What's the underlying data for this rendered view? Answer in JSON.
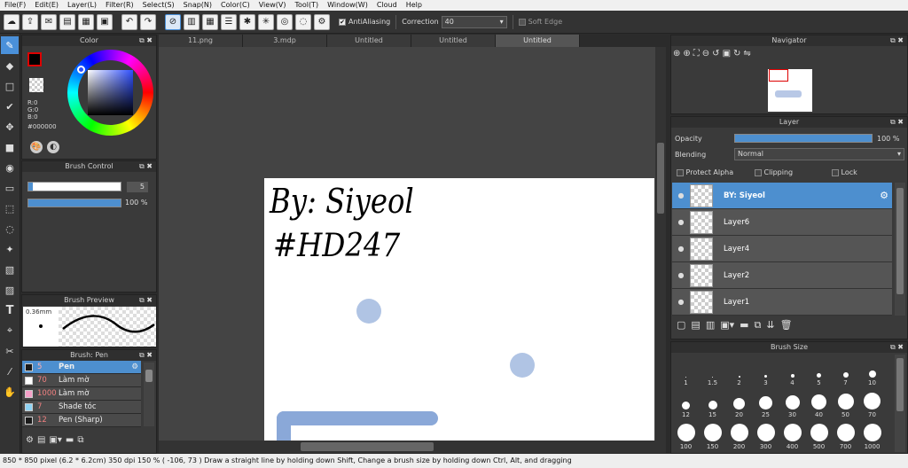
{
  "menu": [
    "File(F)",
    "Edit(E)",
    "Layer(L)",
    "Filter(R)",
    "Select(S)",
    "Snap(N)",
    "Color(C)",
    "View(V)",
    "Tool(T)",
    "Window(W)",
    "Cloud",
    "Help"
  ],
  "toolbar": {
    "antialias_label": "AntiAliasing",
    "correction_label": "Correction",
    "correction_value": "40",
    "soft_edge_label": "Soft Edge"
  },
  "tabs": [
    "11.png",
    "3.mdp",
    "Untitled",
    "Untitled",
    "Untitled"
  ],
  "color_panel": {
    "title": "Color",
    "r": "R:0",
    "g": "G:0",
    "b": "B:0",
    "hex": "#000000"
  },
  "brush_control": {
    "title": "Brush Control",
    "size": "5",
    "opacity": "100 %"
  },
  "brush_preview": {
    "title": "Brush Preview",
    "size": "0.36mm"
  },
  "brush_list": {
    "title": "Brush: Pen",
    "items": [
      {
        "size": "5",
        "name": "Pen",
        "color": "#1a1a1a"
      },
      {
        "size": "70",
        "name": "Làm mờ",
        "color": "#ffffff"
      },
      {
        "size": "1000",
        "name": "Làm mờ",
        "color": "#f5a0c8"
      },
      {
        "size": "7",
        "name": "Shade tóc",
        "color": "#8fd3f4"
      },
      {
        "size": "12",
        "name": "Pen (Sharp)",
        "color": "#1a1a1a"
      }
    ]
  },
  "navigator": {
    "title": "Navigator"
  },
  "layer_panel": {
    "title": "Layer",
    "opacity_label": "Opacity",
    "opacity_value": "100 %",
    "blending_label": "Blending",
    "blending_value": "Normal",
    "protect_alpha": "Protect Alpha",
    "clipping": "Clipping",
    "lock": "Lock",
    "layers": [
      "BY: Siyeol",
      "Layer6",
      "Layer4",
      "Layer2",
      "Layer1"
    ]
  },
  "brush_size": {
    "title": "Brush Size",
    "sizes": [
      "1",
      "1.5",
      "2",
      "3",
      "4",
      "5",
      "7",
      "10",
      "12",
      "15",
      "20",
      "25",
      "30",
      "40",
      "50",
      "70",
      "100",
      "150",
      "200",
      "300",
      "400",
      "500",
      "700",
      "1000"
    ]
  },
  "canvas_text": {
    "line1": "By: Siyeol",
    "line2": "#HD247"
  },
  "status": {
    "text": "850 * 850 pixel   (6.2 * 6.2cm)   350 dpi   150 %   ( -106, 73 )   Draw a straight line by holding down Shift, Change a brush size by holding down Ctrl, Alt, and dragging"
  }
}
